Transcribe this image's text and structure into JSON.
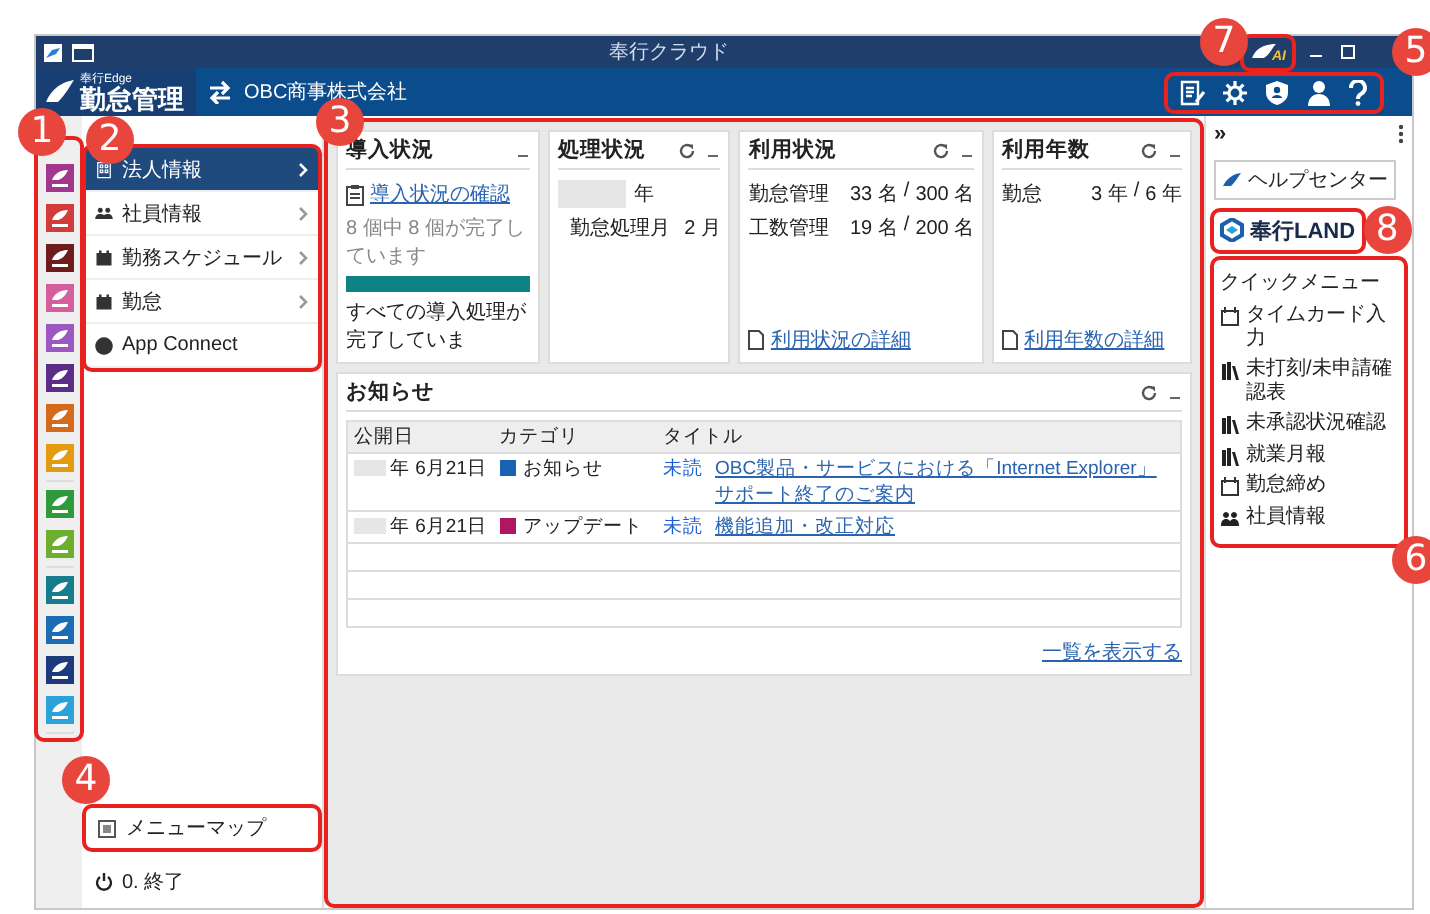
{
  "window": {
    "title": "奉行クラウド",
    "ai_badge": {
      "label": "AI",
      "callout": "7"
    }
  },
  "header": {
    "product_series": "奉行Edge",
    "product": "勤怠管理",
    "company": "OBC商事株式会社",
    "tools_callout": "5"
  },
  "app_rail": {
    "callout": "1",
    "groups": [
      [
        {
          "color": "#a3378e"
        },
        {
          "color": "#d23b3b"
        },
        {
          "color": "#6e1c1c"
        },
        {
          "color": "#d45f9c"
        },
        {
          "color": "#9a58c0"
        },
        {
          "color": "#5b2d89"
        },
        {
          "color": "#d46a1c"
        },
        {
          "color": "#e39c12"
        }
      ],
      [
        {
          "color": "#2f9a3c"
        },
        {
          "color": "#6eae2e"
        }
      ],
      [
        {
          "color": "#177d8c"
        },
        {
          "color": "#1b6cb3"
        },
        {
          "color": "#1c3a7c"
        },
        {
          "color": "#2ba2da"
        }
      ]
    ]
  },
  "menu": {
    "callout": "2",
    "items": [
      {
        "label": "法人情報",
        "selected": true,
        "submenu": true
      },
      {
        "label": "社員情報",
        "selected": false,
        "submenu": true
      },
      {
        "label": "勤務スケジュール",
        "selected": false,
        "submenu": true
      },
      {
        "label": "勤怠",
        "selected": false,
        "submenu": true
      },
      {
        "label": "App Connect",
        "selected": false,
        "submenu": false
      }
    ]
  },
  "menu_map": {
    "label": "メニューマップ",
    "callout": "4"
  },
  "exit": {
    "label": "0. 終了"
  },
  "dashboard": {
    "callout": "3",
    "cards": [
      {
        "kind": "setup",
        "title": "導入状況",
        "refreshable": false,
        "link": "導入状況の確認",
        "progress_text": "8 個中 8 個が完了しています",
        "level": 1,
        "message": "すべての導入処理が完了していま"
      },
      {
        "kind": "processing",
        "title": "処理状況",
        "refreshable": true,
        "year_suffix": "年",
        "rows": [
          {
            "label": "勤怠処理月",
            "value": "2 月"
          }
        ]
      },
      {
        "kind": "usage",
        "title": "利用状況",
        "refreshable": true,
        "rows": [
          {
            "label": "勤怠管理",
            "used": "33 名",
            "separator": "/",
            "total": "300 名"
          },
          {
            "label": "工数管理",
            "used": "19 名",
            "separator": "/",
            "total": "200 名"
          }
        ],
        "link": "利用状況の詳細"
      },
      {
        "kind": "usage",
        "title": "利用年数",
        "refreshable": true,
        "rows": [
          {
            "label": "勤怠",
            "used": "3 年",
            "separator": "/",
            "total": "6 年"
          }
        ],
        "link": "利用年数の詳細"
      }
    ],
    "news": {
      "title": "お知らせ",
      "refreshable": true,
      "columns": [
        "公開日",
        "カテゴリ",
        "タイトル"
      ],
      "rows": [
        {
          "date": "年 6月21日",
          "category": "お知らせ",
          "color": "#1764b5",
          "status": "未読",
          "title": "OBC製品・サービスにおける「Internet Explorer」サポート終了のご案内"
        },
        {
          "date": "年 6月21日",
          "category": "アップデート",
          "color": "#b0175f",
          "status": "未読",
          "title": "機能追加・改正対応"
        }
      ],
      "more": "一覧を表示する"
    }
  },
  "right_panel": {
    "collapse": "»",
    "help_center": "ヘルプセンター",
    "land": {
      "label": "奉行LAND",
      "callout": "8"
    },
    "quick_menu": {
      "title": "クイックメニュー",
      "callout": "6",
      "items": [
        {
          "label": "タイムカード入力"
        },
        {
          "label": "未打刻/未申請確認表"
        },
        {
          "label": "未承認状況確認"
        },
        {
          "label": "就業月報"
        },
        {
          "label": "勤怠締め"
        },
        {
          "label": "社員情報"
        }
      ]
    }
  }
}
